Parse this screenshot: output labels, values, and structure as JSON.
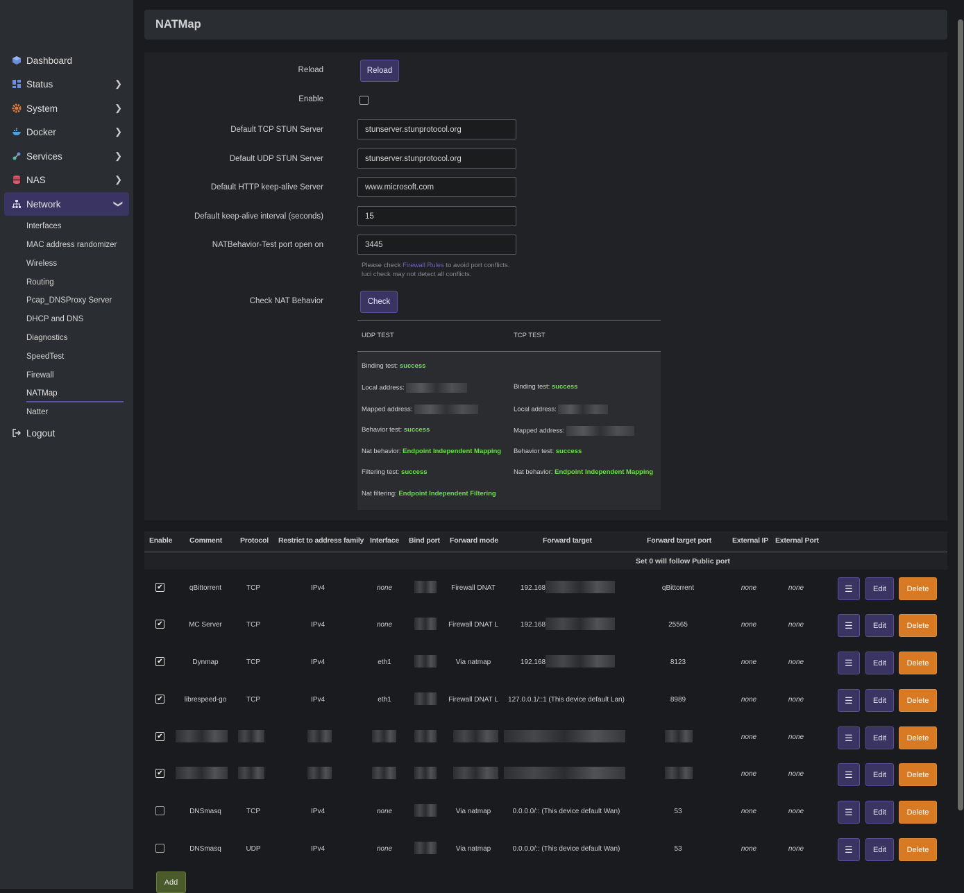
{
  "header": {
    "title": "NATMap"
  },
  "sidebar": {
    "items": [
      {
        "label": "Dashboard",
        "icon": "cube-icon"
      },
      {
        "label": "Status",
        "icon": "grid-icon"
      },
      {
        "label": "System",
        "icon": "gear-icon"
      },
      {
        "label": "Docker",
        "icon": "docker-icon"
      },
      {
        "label": "Services",
        "icon": "services-icon"
      },
      {
        "label": "NAS",
        "icon": "database-icon"
      },
      {
        "label": "Network",
        "icon": "network-icon"
      }
    ],
    "subitems": [
      "Interfaces",
      "MAC address randomizer",
      "Wireless",
      "Routing",
      "Pcap_DNSProxy Server",
      "DHCP and DNS",
      "Diagnostics",
      "SpeedTest",
      "Firewall",
      "NATMap",
      "Natter"
    ],
    "logout": "Logout",
    "active_color": "#3a3463"
  },
  "settings": {
    "reload_label": "Reload",
    "reload_button": "Reload",
    "enable_label": "Enable",
    "tcp_stun_label": "Default TCP STUN Server",
    "tcp_stun_value": "stunserver.stunprotocol.org",
    "udp_stun_label": "Default UDP STUN Server",
    "udp_stun_value": "stunserver.stunprotocol.org",
    "http_label": "Default HTTP keep-alive Server",
    "http_value": "www.microsoft.com",
    "interval_label": "Default keep-alive interval (seconds)",
    "interval_value": "15",
    "port_label": "NATBehavior-Test port open on",
    "port_value": "3445",
    "hint_prefix": "Please check ",
    "hint_link": "Firewall Rules",
    "hint_suffix": " to avoid port conflicts.",
    "hint_line2": "luci check may not detect all conflicts.",
    "check_label": "Check NAT Behavior",
    "check_button": "Check"
  },
  "nat_result": {
    "udp_header": "UDP TEST",
    "tcp_header": "TCP TEST",
    "udp": [
      {
        "k": "Binding test: ",
        "v": "success"
      },
      {
        "k": "Local address: ",
        "v": ""
      },
      {
        "k": "Mapped address: ",
        "v": ""
      },
      {
        "k": "Behavior test: ",
        "v": "success"
      },
      {
        "k": "Nat behavior: ",
        "v": "Endpoint Independent Mapping"
      },
      {
        "k": "Filtering test: ",
        "v": "success"
      },
      {
        "k": "Nat filtering: ",
        "v": "Endpoint Independent Filtering"
      }
    ],
    "tcp": [
      {
        "k": "Binding test: ",
        "v": "success"
      },
      {
        "k": "Local address: ",
        "v": ""
      },
      {
        "k": "Mapped address: ",
        "v": ""
      },
      {
        "k": "Behavior test: ",
        "v": "success"
      },
      {
        "k": "Nat behavior: ",
        "v": "Endpoint Independent Mapping"
      }
    ]
  },
  "table": {
    "columns": [
      "Enable",
      "Comment",
      "Protocol",
      "Restrict to address family",
      "Interface",
      "Bind port",
      "Forward mode",
      "Forward target",
      "Forward target port",
      "External IP",
      "External Port"
    ],
    "sub_header": "Set 0 will follow Public port",
    "rows": [
      {
        "enabled": true,
        "comment": "qBittorrent",
        "protocol": "TCP",
        "family": "IPv4",
        "iface": "none",
        "mode": "Firewall DNAT",
        "target": "192.168",
        "tport": "qBittorrent",
        "extip": "none",
        "extport": "none"
      },
      {
        "enabled": true,
        "comment": "MC Server",
        "protocol": "TCP",
        "family": "IPv4",
        "iface": "none",
        "mode": "Firewall DNAT L",
        "target": "192.168",
        "tport": "25565",
        "extip": "none",
        "extport": "none"
      },
      {
        "enabled": true,
        "comment": "Dynmap",
        "protocol": "TCP",
        "family": "IPv4",
        "iface": "eth1",
        "mode": "Via natmap",
        "target": "192.168",
        "tport": "8123",
        "extip": "none",
        "extport": "none"
      },
      {
        "enabled": true,
        "comment": "librespeed-go",
        "protocol": "TCP",
        "family": "IPv4",
        "iface": "eth1",
        "mode": "Firewall DNAT L",
        "target": "127.0.0.1/::1 (This device default Lan)",
        "tport": "8989",
        "extip": "none",
        "extport": "none"
      },
      {
        "enabled": true,
        "comment": "",
        "protocol": "",
        "family": "",
        "iface": "",
        "mode": "",
        "target": "",
        "tport": "",
        "extip": "none",
        "extport": "none"
      },
      {
        "enabled": true,
        "comment": "",
        "protocol": "",
        "family": "",
        "iface": "",
        "mode": "",
        "target": "",
        "tport": "",
        "extip": "none",
        "extport": "none"
      },
      {
        "enabled": false,
        "comment": "DNSmasq",
        "protocol": "TCP",
        "family": "IPv4",
        "iface": "none",
        "mode": "Via natmap",
        "target": "0.0.0.0/:: (This device default Wan)",
        "tport": "53",
        "extip": "none",
        "extport": "none"
      },
      {
        "enabled": false,
        "comment": "DNSmasq",
        "protocol": "UDP",
        "family": "IPv4",
        "iface": "none",
        "mode": "Via natmap",
        "target": "0.0.0.0/:: (This device default Wan)",
        "tport": "53",
        "extip": "none",
        "extport": "none"
      }
    ],
    "menu_glyph": "☰",
    "edit_label": "Edit",
    "delete_label": "Delete",
    "add_label": "Add"
  }
}
